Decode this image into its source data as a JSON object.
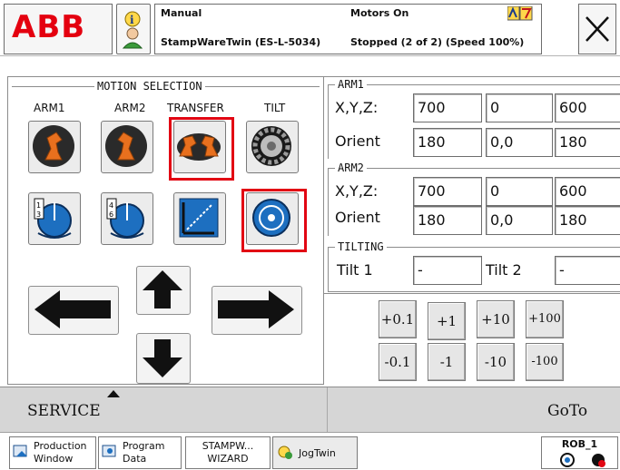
{
  "status": {
    "mode": "Manual",
    "system": "StampWareTwin (ES-L-5034)",
    "motors": "Motors On",
    "state": "Stopped (2 of 2) (Speed 100%)"
  },
  "motion_selection": {
    "title": "MOTION SELECTION",
    "columns": [
      "ARM1",
      "ARM2",
      "TRANSFER",
      "TILT"
    ]
  },
  "arm1": {
    "title": "ARM1",
    "xyz_label": "X,Y,Z:",
    "orient_label": "Orient",
    "xyz": [
      "700",
      "0",
      "600"
    ],
    "orient": [
      "180",
      "0,0",
      "180"
    ]
  },
  "arm2": {
    "title": "ARM2",
    "xyz_label": "X,Y,Z:",
    "orient_label": "Orient",
    "xyz": [
      "700",
      "0",
      "600"
    ],
    "orient": [
      "180",
      "0,0",
      "180"
    ]
  },
  "tilting": {
    "title": "TILTING",
    "tilt1_label": "Tilt 1",
    "tilt1_value": "-",
    "tilt2_label": "Tilt 2",
    "tilt2_value": "-"
  },
  "steps": {
    "plus": [
      "+0.1",
      "+1",
      "+10",
      "+100"
    ],
    "minus": [
      "-0.1",
      "-1",
      "-10",
      "-100"
    ]
  },
  "bottom": {
    "service": "SERVICE",
    "goto": "GoTo"
  },
  "taskbar": {
    "production_1": "Production",
    "production_2": "Window",
    "program_1": "Program",
    "program_2": "Data",
    "stamp_1": "STAMPW...",
    "stamp_2": "WIZARD",
    "jog": "JogTwin",
    "robot": "ROB_1"
  },
  "colors": {
    "abb_red": "#e4000f",
    "selection_red": "#e20613",
    "robot_orange": "#e8701e"
  }
}
